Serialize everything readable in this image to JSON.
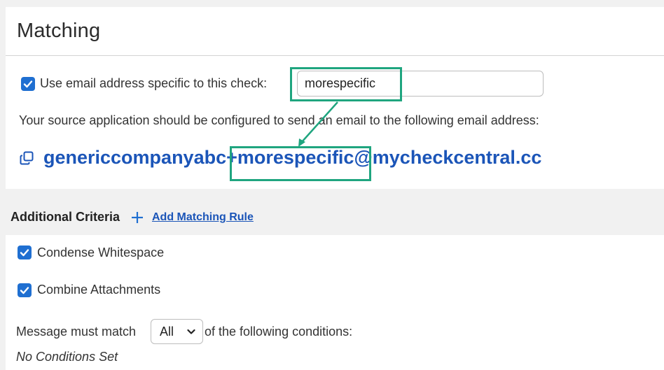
{
  "section": {
    "title": "Matching"
  },
  "specific_email": {
    "checkbox_label": "Use email address specific to this check:",
    "checked": true,
    "input_value": "morespecific",
    "source_text": "Your source application should be configured to send an email to the following email address:",
    "email_prefix": "genericcompanyabc",
    "email_specific": "+morespecific",
    "email_domain": "@mycheckcentral.cc",
    "copy_icon": "copy-icon"
  },
  "additional_criteria": {
    "title": "Additional Criteria",
    "add_icon": "plus-icon",
    "add_rule_label": "Add Matching Rule"
  },
  "options": {
    "condense_whitespace_label": "Condense Whitespace",
    "condense_whitespace_checked": true,
    "combine_attachments_label": "Combine Attachments",
    "combine_attachments_checked": true
  },
  "match": {
    "prefix": "Message must match",
    "selected": "All",
    "suffix": "of the following conditions:",
    "no_conditions": "No Conditions Set"
  },
  "colors": {
    "accent": "#1f6fd1",
    "link": "#1b55b8",
    "highlight": "#1fa57f"
  }
}
